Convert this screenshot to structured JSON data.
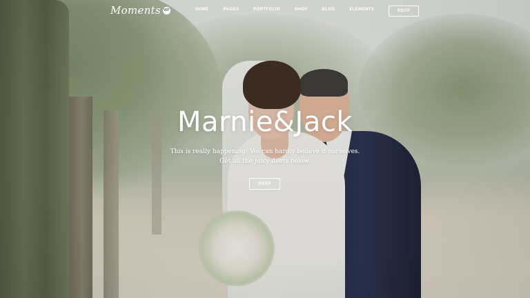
{
  "header": {
    "logo_text": "Moments",
    "logo_badge": "WP",
    "nav": [
      {
        "label": "HOME"
      },
      {
        "label": "PAGES"
      },
      {
        "label": "PORTFOLIO"
      },
      {
        "label": "SHOP"
      },
      {
        "label": "BLOG"
      },
      {
        "label": "ELEMENTS"
      }
    ],
    "rsvp_label": "RSVP"
  },
  "hero": {
    "title": "Marnie&Jack",
    "subtitle_line1": "This is really happening! We can hardly believe it ourselves.",
    "subtitle_line2": "Get all the juicy deets below.",
    "rsvp_label": "RSVP"
  },
  "colors": {
    "text": "#ffffff",
    "suit": "#1d2338",
    "foliage": "#8e9c7c"
  }
}
